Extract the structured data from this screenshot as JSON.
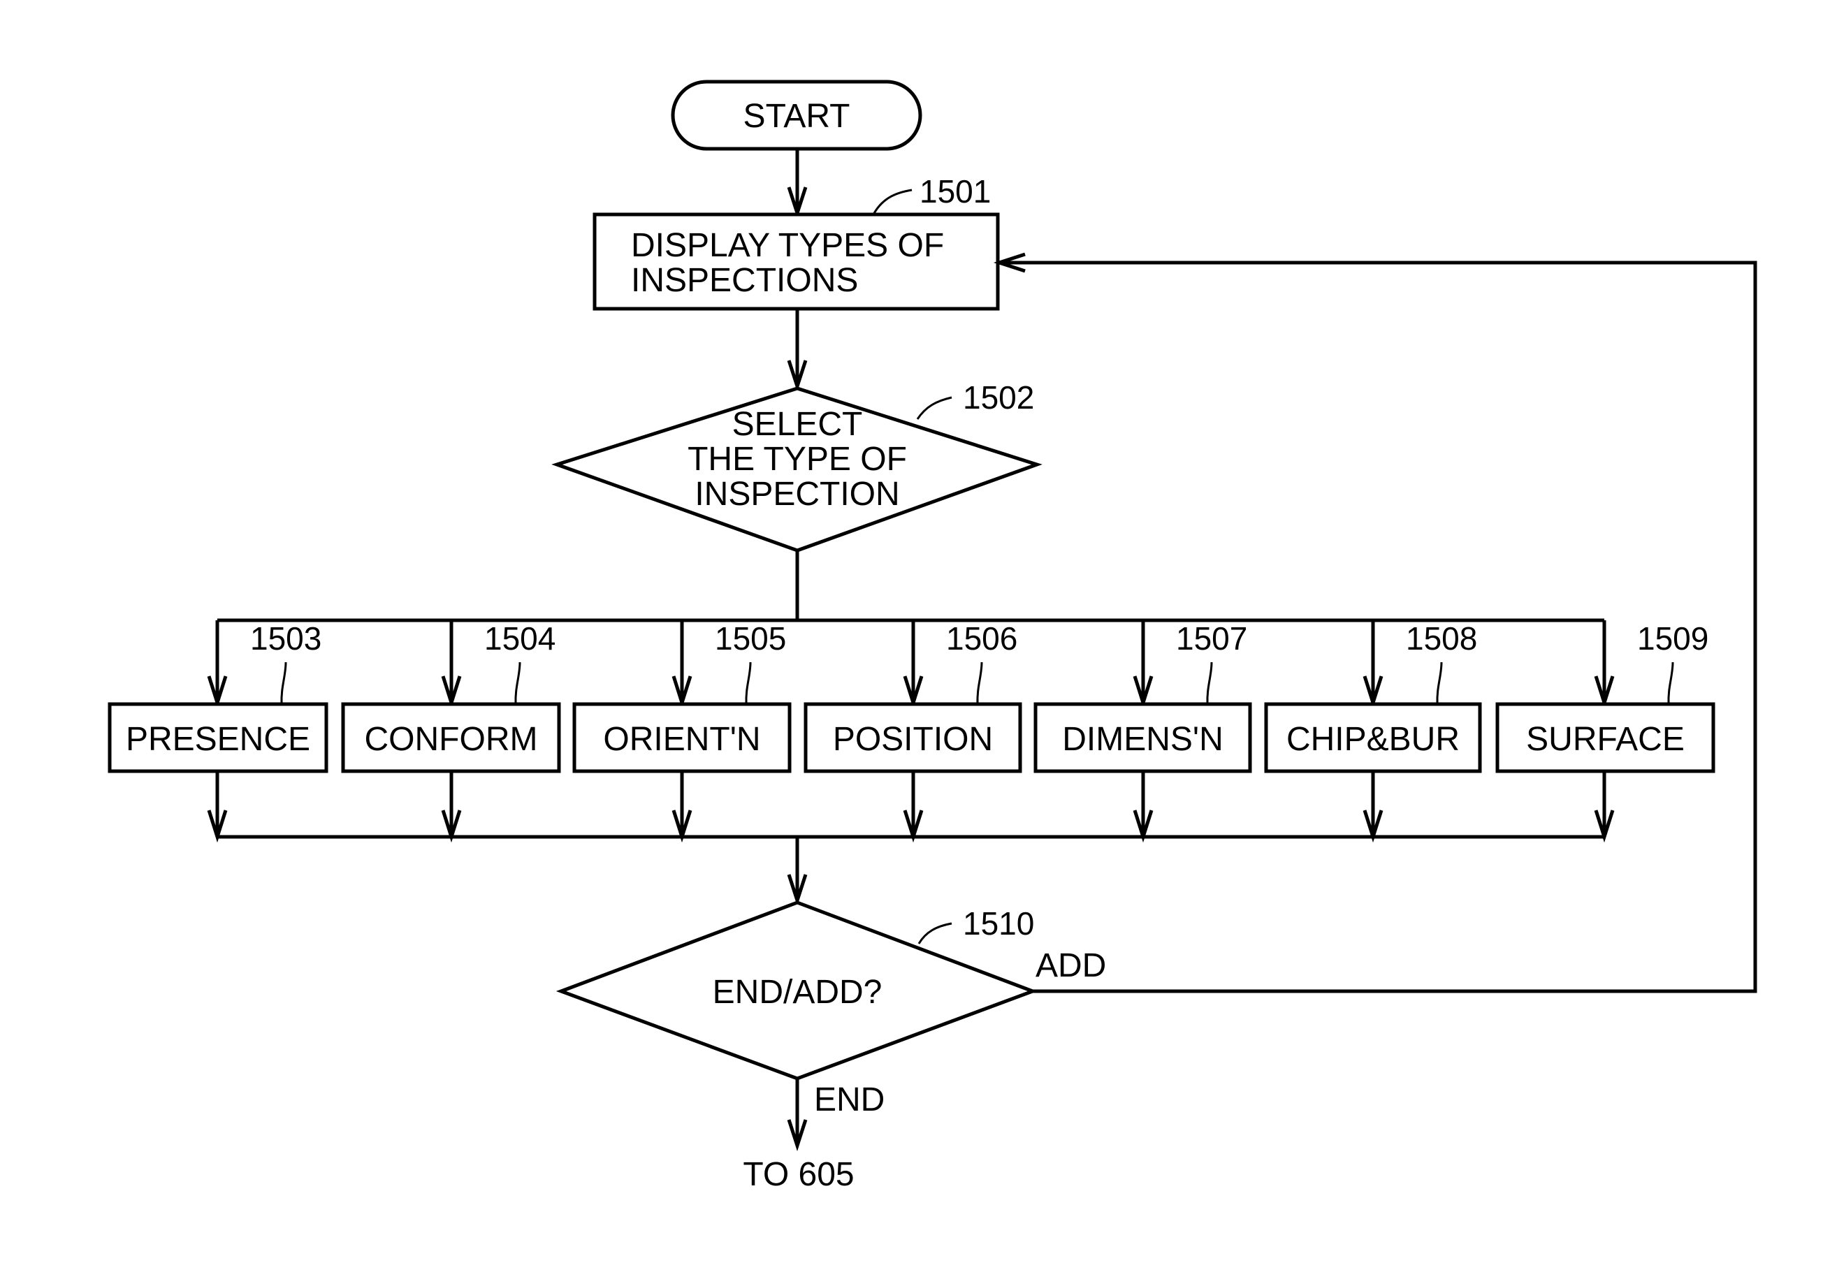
{
  "diagram": {
    "type": "flowchart",
    "start": {
      "label": "START"
    },
    "display": {
      "ref": "1501",
      "lines": [
        "DISPLAY TYPES OF",
        "INSPECTIONS"
      ]
    },
    "select": {
      "ref": "1502",
      "lines": [
        "SELECT",
        "THE TYPE OF",
        "INSPECTION"
      ]
    },
    "inspections": [
      {
        "ref": "1503",
        "label": "PRESENCE"
      },
      {
        "ref": "1504",
        "label": "CONFORM"
      },
      {
        "ref": "1505",
        "label": "ORIENT'N"
      },
      {
        "ref": "1506",
        "label": "POSITION"
      },
      {
        "ref": "1507",
        "label": "DIMENS'N"
      },
      {
        "ref": "1508",
        "label": "CHIP&BUR"
      },
      {
        "ref": "1509",
        "label": "SURFACE"
      }
    ],
    "decision": {
      "ref": "1510",
      "label": "END/ADD?",
      "add_label": "ADD",
      "end_label": "END"
    },
    "terminal": {
      "label": "TO 605"
    }
  }
}
